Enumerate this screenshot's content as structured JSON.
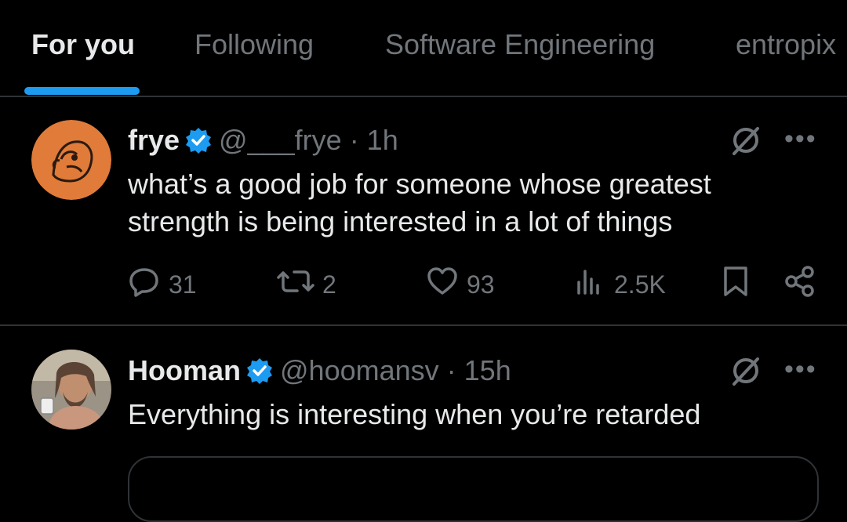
{
  "tabs": [
    {
      "label": "For you",
      "active": true
    },
    {
      "label": "Following",
      "active": false
    },
    {
      "label": "Software Engineering",
      "active": false
    },
    {
      "label": "entropix",
      "active": false
    }
  ],
  "colors": {
    "accent": "#1d9bf0",
    "verified": "#1d9bf0",
    "muted": "#71767b",
    "text": "#e7e9ea"
  },
  "tweets": [
    {
      "name": "frye",
      "handle": "@___frye",
      "time": "· 1h",
      "text": "what’s a good job for someone whose greatest\nstrength is being interested in a lot of things",
      "stats": {
        "replies": "31",
        "reposts": "2",
        "likes": "93",
        "views": "2.5K"
      }
    },
    {
      "name": "Hooman",
      "handle": "@hoomansv",
      "time": "· 15h",
      "text": "Everything is interesting when you’re retarded"
    }
  ],
  "icons": {
    "reply": "reply-icon",
    "repost": "repost-icon",
    "like": "heart-icon",
    "views": "views-icon",
    "bookmark": "bookmark-icon",
    "share": "share-icon",
    "grok": "grok-icon",
    "more": "more-icon",
    "verified": "verified-badge-icon"
  }
}
